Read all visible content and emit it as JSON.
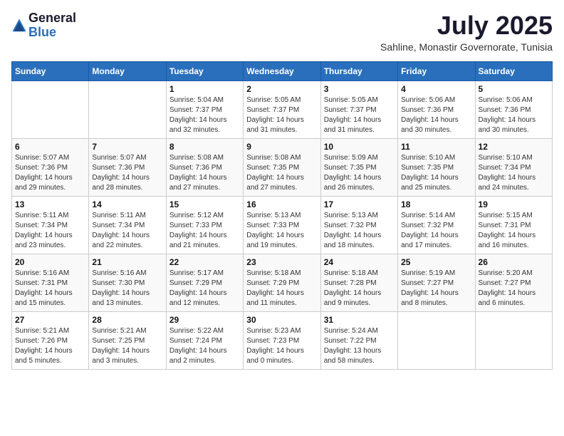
{
  "logo": {
    "general": "General",
    "blue": "Blue"
  },
  "title": {
    "month_year": "July 2025",
    "location": "Sahline, Monastir Governorate, Tunisia"
  },
  "header_days": [
    "Sunday",
    "Monday",
    "Tuesday",
    "Wednesday",
    "Thursday",
    "Friday",
    "Saturday"
  ],
  "weeks": [
    [
      {
        "day": "",
        "info": ""
      },
      {
        "day": "",
        "info": ""
      },
      {
        "day": "1",
        "info": "Sunrise: 5:04 AM\nSunset: 7:37 PM\nDaylight: 14 hours and 32 minutes."
      },
      {
        "day": "2",
        "info": "Sunrise: 5:05 AM\nSunset: 7:37 PM\nDaylight: 14 hours and 31 minutes."
      },
      {
        "day": "3",
        "info": "Sunrise: 5:05 AM\nSunset: 7:37 PM\nDaylight: 14 hours and 31 minutes."
      },
      {
        "day": "4",
        "info": "Sunrise: 5:06 AM\nSunset: 7:36 PM\nDaylight: 14 hours and 30 minutes."
      },
      {
        "day": "5",
        "info": "Sunrise: 5:06 AM\nSunset: 7:36 PM\nDaylight: 14 hours and 30 minutes."
      }
    ],
    [
      {
        "day": "6",
        "info": "Sunrise: 5:07 AM\nSunset: 7:36 PM\nDaylight: 14 hours and 29 minutes."
      },
      {
        "day": "7",
        "info": "Sunrise: 5:07 AM\nSunset: 7:36 PM\nDaylight: 14 hours and 28 minutes."
      },
      {
        "day": "8",
        "info": "Sunrise: 5:08 AM\nSunset: 7:36 PM\nDaylight: 14 hours and 27 minutes."
      },
      {
        "day": "9",
        "info": "Sunrise: 5:08 AM\nSunset: 7:35 PM\nDaylight: 14 hours and 27 minutes."
      },
      {
        "day": "10",
        "info": "Sunrise: 5:09 AM\nSunset: 7:35 PM\nDaylight: 14 hours and 26 minutes."
      },
      {
        "day": "11",
        "info": "Sunrise: 5:10 AM\nSunset: 7:35 PM\nDaylight: 14 hours and 25 minutes."
      },
      {
        "day": "12",
        "info": "Sunrise: 5:10 AM\nSunset: 7:34 PM\nDaylight: 14 hours and 24 minutes."
      }
    ],
    [
      {
        "day": "13",
        "info": "Sunrise: 5:11 AM\nSunset: 7:34 PM\nDaylight: 14 hours and 23 minutes."
      },
      {
        "day": "14",
        "info": "Sunrise: 5:11 AM\nSunset: 7:34 PM\nDaylight: 14 hours and 22 minutes."
      },
      {
        "day": "15",
        "info": "Sunrise: 5:12 AM\nSunset: 7:33 PM\nDaylight: 14 hours and 21 minutes."
      },
      {
        "day": "16",
        "info": "Sunrise: 5:13 AM\nSunset: 7:33 PM\nDaylight: 14 hours and 19 minutes."
      },
      {
        "day": "17",
        "info": "Sunrise: 5:13 AM\nSunset: 7:32 PM\nDaylight: 14 hours and 18 minutes."
      },
      {
        "day": "18",
        "info": "Sunrise: 5:14 AM\nSunset: 7:32 PM\nDaylight: 14 hours and 17 minutes."
      },
      {
        "day": "19",
        "info": "Sunrise: 5:15 AM\nSunset: 7:31 PM\nDaylight: 14 hours and 16 minutes."
      }
    ],
    [
      {
        "day": "20",
        "info": "Sunrise: 5:16 AM\nSunset: 7:31 PM\nDaylight: 14 hours and 15 minutes."
      },
      {
        "day": "21",
        "info": "Sunrise: 5:16 AM\nSunset: 7:30 PM\nDaylight: 14 hours and 13 minutes."
      },
      {
        "day": "22",
        "info": "Sunrise: 5:17 AM\nSunset: 7:29 PM\nDaylight: 14 hours and 12 minutes."
      },
      {
        "day": "23",
        "info": "Sunrise: 5:18 AM\nSunset: 7:29 PM\nDaylight: 14 hours and 11 minutes."
      },
      {
        "day": "24",
        "info": "Sunrise: 5:18 AM\nSunset: 7:28 PM\nDaylight: 14 hours and 9 minutes."
      },
      {
        "day": "25",
        "info": "Sunrise: 5:19 AM\nSunset: 7:27 PM\nDaylight: 14 hours and 8 minutes."
      },
      {
        "day": "26",
        "info": "Sunrise: 5:20 AM\nSunset: 7:27 PM\nDaylight: 14 hours and 6 minutes."
      }
    ],
    [
      {
        "day": "27",
        "info": "Sunrise: 5:21 AM\nSunset: 7:26 PM\nDaylight: 14 hours and 5 minutes."
      },
      {
        "day": "28",
        "info": "Sunrise: 5:21 AM\nSunset: 7:25 PM\nDaylight: 14 hours and 3 minutes."
      },
      {
        "day": "29",
        "info": "Sunrise: 5:22 AM\nSunset: 7:24 PM\nDaylight: 14 hours and 2 minutes."
      },
      {
        "day": "30",
        "info": "Sunrise: 5:23 AM\nSunset: 7:23 PM\nDaylight: 14 hours and 0 minutes."
      },
      {
        "day": "31",
        "info": "Sunrise: 5:24 AM\nSunset: 7:22 PM\nDaylight: 13 hours and 58 minutes."
      },
      {
        "day": "",
        "info": ""
      },
      {
        "day": "",
        "info": ""
      }
    ]
  ]
}
